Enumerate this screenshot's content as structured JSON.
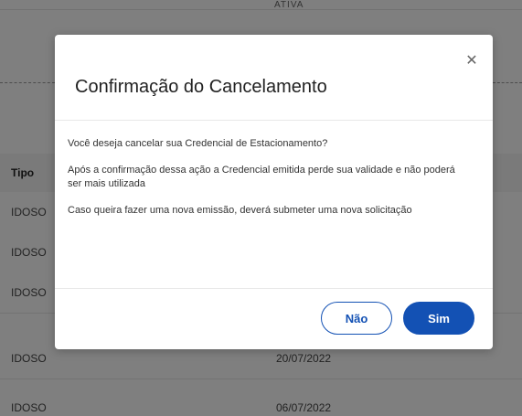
{
  "background": {
    "top_text": "ATIVA",
    "table": {
      "headers": [
        "Tipo"
      ],
      "rows": [
        {
          "tipo": "IDOSO",
          "data": ""
        },
        {
          "tipo": "IDOSO",
          "data": ""
        },
        {
          "tipo": "IDOSO",
          "data": ""
        },
        {
          "tipo": "IDOSO",
          "data": "20/07/2022"
        },
        {
          "tipo": "IDOSO",
          "data": "06/07/2022"
        }
      ]
    }
  },
  "modal": {
    "title": "Confirmação do Cancelamento",
    "close_icon": "close-icon",
    "paragraphs": [
      "Você deseja cancelar sua Credencial de Estacionamento?",
      "Após a confirmação dessa ação a Credencial emitida perde sua validade e não poderá ser mais utilizada",
      "Caso queira fazer uma nova emissão, deverá submeter uma nova solicitação"
    ],
    "buttons": {
      "no_label": "Não",
      "yes_label": "Sim"
    }
  },
  "colors": {
    "primary": "#1351b4",
    "overlay": "rgba(0,0,0,0.5)"
  }
}
